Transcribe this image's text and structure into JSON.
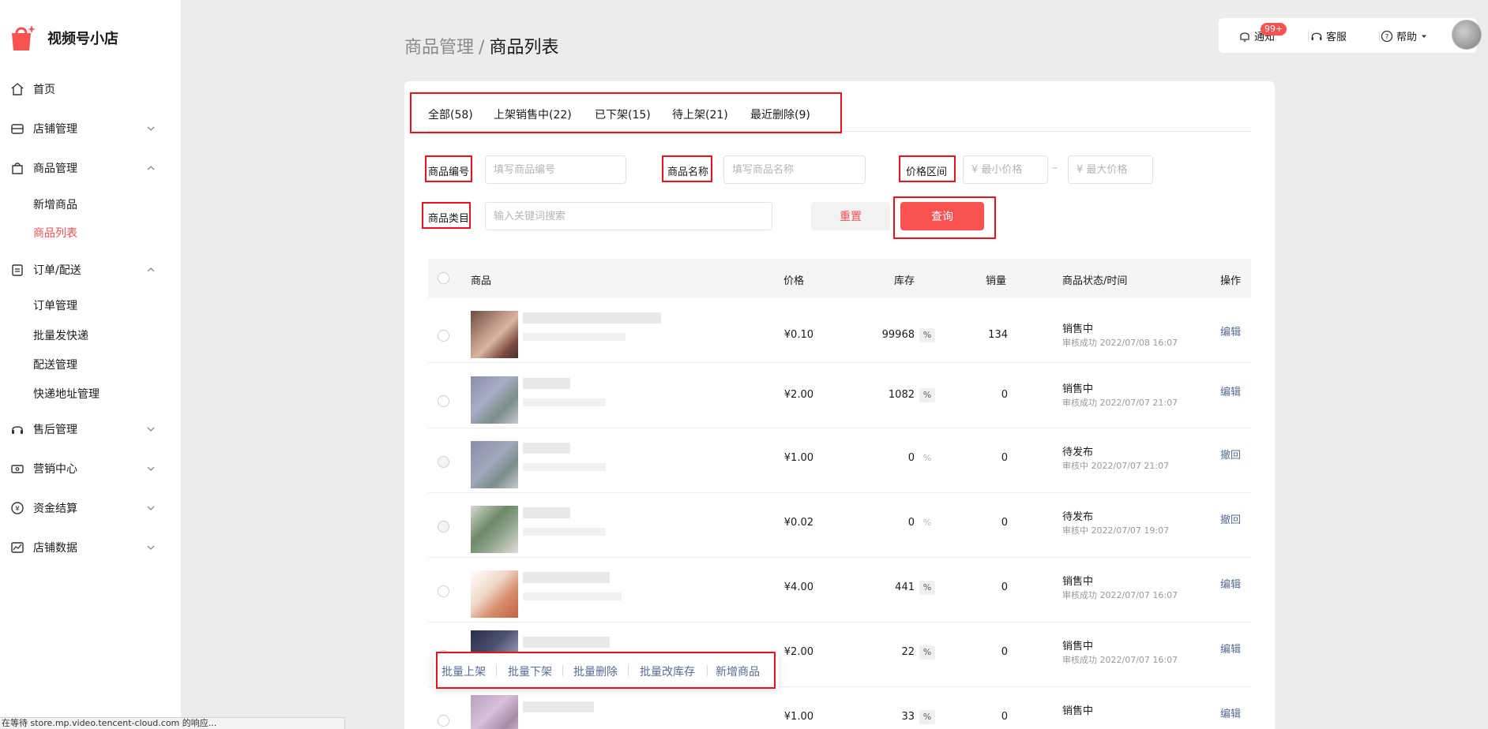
{
  "app": {
    "name": "视频号小店",
    "brand_color": "#fa5151"
  },
  "sidebar": {
    "items": [
      {
        "label": "首页",
        "icon": "home-icon"
      },
      {
        "label": "店铺管理",
        "icon": "store-icon"
      },
      {
        "label": "商品管理",
        "icon": "bag-icon"
      },
      {
        "label": "订单/配送",
        "icon": "clipboard-icon"
      },
      {
        "label": "售后管理",
        "icon": "headset-icon"
      },
      {
        "label": "营销中心",
        "icon": "ticket-icon"
      },
      {
        "label": "资金结算",
        "icon": "yen-icon"
      },
      {
        "label": "店铺数据",
        "icon": "chart-icon"
      }
    ],
    "product_sub": [
      "新增商品",
      "商品列表"
    ],
    "order_sub": [
      "订单管理",
      "批量发快递",
      "配送管理",
      "快递地址管理"
    ]
  },
  "toolbar": {
    "notify_label": "通知",
    "notify_badge": "99+",
    "service_label": "客服",
    "help_label": "帮助"
  },
  "breadcrumb": {
    "parent": "商品管理",
    "separator": "/",
    "current": "商品列表"
  },
  "tabs": [
    "全部(58)",
    "上架销售中(22)",
    "已下架(15)",
    "待上架(21)",
    "最近删除(9)"
  ],
  "filters": {
    "code_label": "商品编号",
    "code_placeholder": "填写商品编号",
    "name_label": "商品名称",
    "name_placeholder": "填写商品名称",
    "price_label": "价格区间",
    "min_price_placeholder": "¥ 最小价格",
    "max_price_placeholder": "¥ 最大价格",
    "range_dash": "–",
    "category_label": "商品类目",
    "category_placeholder": "输入关键词搜索",
    "reset_label": "重置",
    "query_label": "查询"
  },
  "table": {
    "headers": [
      "商品",
      "价格",
      "库存",
      "销量",
      "商品状态/时间",
      "操作"
    ],
    "pct_symbol": "%",
    "rows": [
      {
        "price": "¥0.10",
        "stock": "99968",
        "sales": "134",
        "status": "销售中",
        "time": "审核成功 2022/07/08 16:07",
        "action": "编辑"
      },
      {
        "price": "¥2.00",
        "stock": "1082",
        "sales": "0",
        "status": "销售中",
        "time": "审核成功 2022/07/07 21:07",
        "action": "编辑"
      },
      {
        "price": "¥1.00",
        "stock": "0",
        "sales": "0",
        "status": "待发布",
        "time": "审核中 2022/07/07 21:07",
        "action": "撤回"
      },
      {
        "price": "¥0.02",
        "stock": "0",
        "sales": "0",
        "status": "待发布",
        "time": "审核中 2022/07/07 19:07",
        "action": "撤回"
      },
      {
        "price": "¥4.00",
        "stock": "441",
        "sales": "0",
        "status": "销售中",
        "time": "审核成功 2022/07/07 16:07",
        "action": "编辑"
      },
      {
        "price": "¥2.00",
        "stock": "22",
        "sales": "0",
        "status": "销售中",
        "time": "审核成功 2022/07/07 16:07",
        "action": "编辑"
      },
      {
        "price": "¥1.00",
        "stock": "33",
        "sales": "0",
        "status": "销售中",
        "time": "",
        "action": "编辑"
      }
    ]
  },
  "bulk_actions": [
    "批量上架",
    "批量下架",
    "批量删除",
    "批量改库存",
    "新增商品"
  ],
  "statusbar_text": "在等待 store.mp.video.tencent-cloud.com 的响应..."
}
